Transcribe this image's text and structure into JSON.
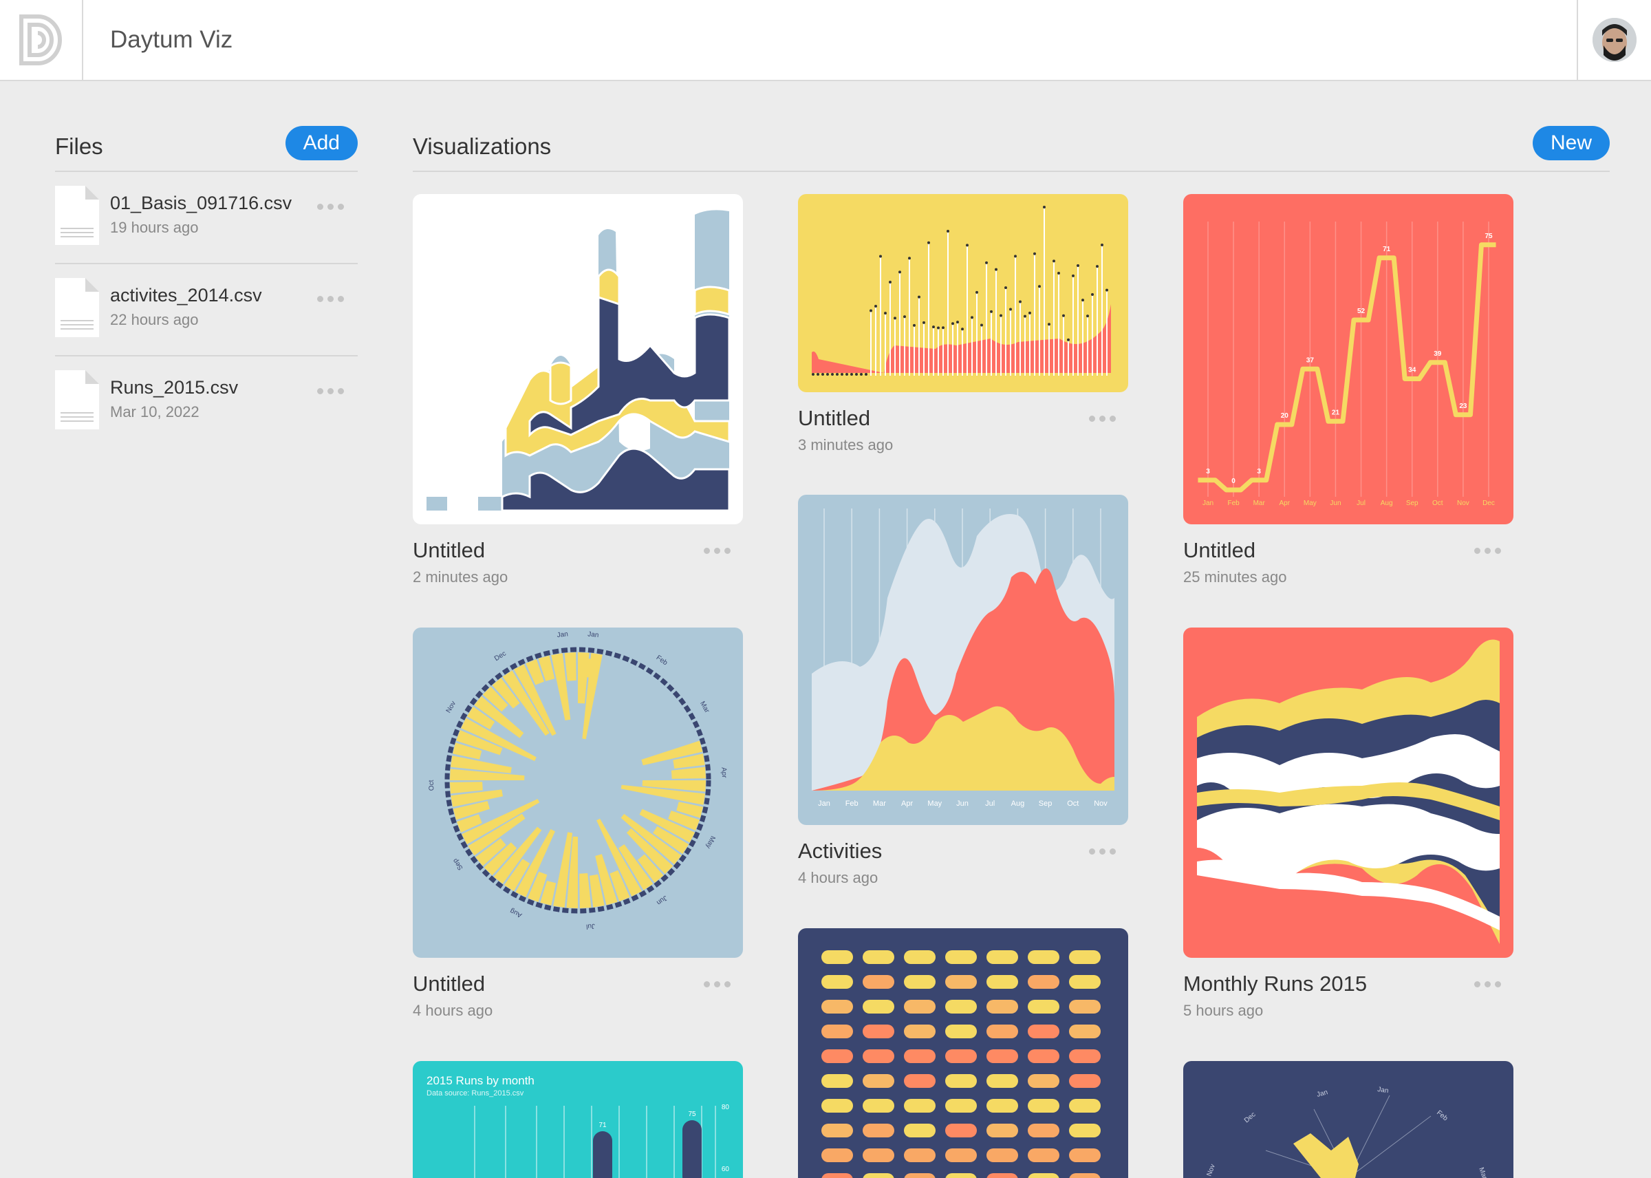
{
  "app": {
    "title": "Daytum Viz",
    "logo_icon": "daytum-logo-icon",
    "avatar_icon": "user-avatar-icon"
  },
  "files": {
    "title": "Files",
    "add_label": "Add",
    "items": [
      {
        "name": "01_Basis_091716.csv",
        "time": "19 hours ago"
      },
      {
        "name": "activites_2014.csv",
        "time": "22 hours ago"
      },
      {
        "name": "Runs_2015.csv",
        "time": "Mar 10, 2022"
      }
    ]
  },
  "visualizations": {
    "title": "Visualizations",
    "new_label": "New",
    "cards": [
      {
        "title": "Untitled",
        "time": "2 minutes ago"
      },
      {
        "title": "Untitled",
        "time": "3 minutes ago"
      },
      {
        "title": "Untitled",
        "time": "25 minutes ago"
      },
      {
        "title": "Untitled",
        "time": "4 hours ago"
      },
      {
        "title": "Activities",
        "time": "4 hours ago"
      },
      {
        "title": "Monthly Runs 2015",
        "time": "5 hours ago"
      }
    ],
    "step_chart": {
      "months": [
        "Jan",
        "Feb",
        "Mar",
        "Apr",
        "May",
        "Jun",
        "Jul",
        "Aug",
        "Sep",
        "Oct",
        "Nov",
        "Dec"
      ],
      "values": [
        3,
        0,
        3,
        20,
        37,
        21,
        52,
        71,
        34,
        39,
        23,
        75
      ]
    },
    "area_chart": {
      "months": [
        "Jan",
        "Feb",
        "Mar",
        "Apr",
        "May",
        "Jun",
        "Jul",
        "Aug",
        "Sep",
        "Oct",
        "Nov"
      ]
    },
    "radial_chart": {
      "months": [
        "Jan",
        "Jan",
        "Feb",
        "Mar",
        "Apr",
        "May",
        "Jun",
        "Jul",
        "Aug",
        "Sep",
        "Oct",
        "Nov",
        "Dec"
      ]
    },
    "teal_chart": {
      "title": "2015 Runs by month",
      "subtitle": "Data source: Runs_2015.csv",
      "labels": [
        "71",
        "75"
      ],
      "ticks": [
        "80",
        "60"
      ]
    },
    "navy_radial": {
      "months": [
        "Jan",
        "Jan",
        "Feb",
        "Dec",
        "Nov",
        "Mar"
      ]
    }
  },
  "colors": {
    "yellow": "#f5da63",
    "coral": "#fe6e63",
    "lightblue": "#adc8d8",
    "navy": "#3a4670",
    "teal": "#2bcbcb",
    "accent": "#1e88e5"
  }
}
